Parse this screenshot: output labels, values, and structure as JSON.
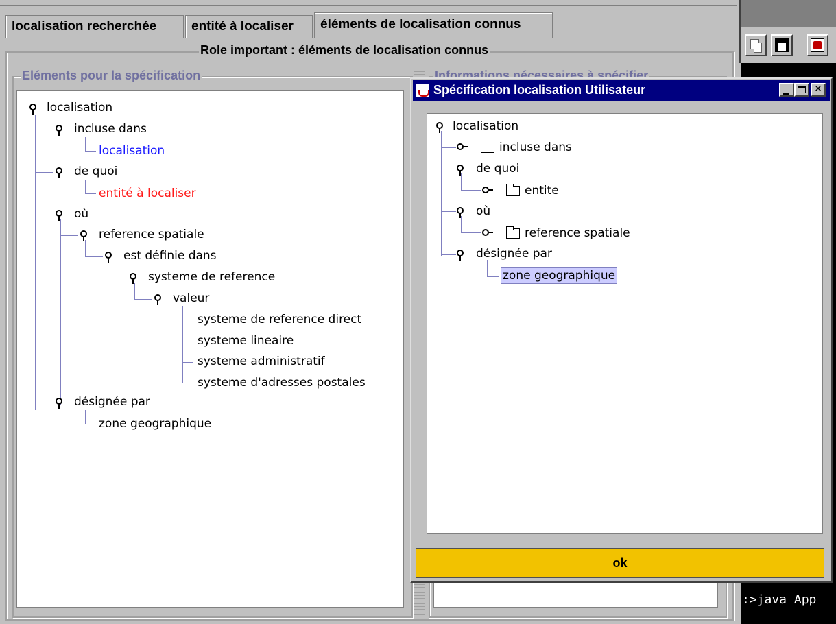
{
  "tabs": [
    {
      "label": "localisation recherchée"
    },
    {
      "label": "entité à localiser"
    },
    {
      "label": "éléments de localisation connus"
    }
  ],
  "main_panel": {
    "title": "Role important : éléments de localisation connus",
    "left_panel_title": "Eléments pour la spécification",
    "right_panel_title_partial": "Informations nécessaires à spécifier"
  },
  "left_tree": [
    {
      "label": "localisation"
    },
    {
      "label": "incluse dans"
    },
    {
      "label": "localisation",
      "color": "#1a1aff"
    },
    {
      "label": "de quoi"
    },
    {
      "label": "entité à localiser",
      "color": "#ff1a1a"
    },
    {
      "label": "où"
    },
    {
      "label": "reference spatiale"
    },
    {
      "label": "est définie dans"
    },
    {
      "label": "systeme de reference"
    },
    {
      "label": "valeur"
    },
    {
      "label": "systeme de reference direct"
    },
    {
      "label": "systeme lineaire"
    },
    {
      "label": "systeme administratif"
    },
    {
      "label": "systeme d'adresses postales"
    },
    {
      "label": "désignée par"
    },
    {
      "label": "zone geographique"
    }
  ],
  "dialog": {
    "title": "Spécification localisation Utilisateur",
    "tree": [
      {
        "label": "localisation"
      },
      {
        "label": "incluse dans"
      },
      {
        "label": "de quoi"
      },
      {
        "label": "entite"
      },
      {
        "label": "où"
      },
      {
        "label": "reference spatiale"
      },
      {
        "label": "désignée par"
      },
      {
        "label": "zone geographique",
        "selected": true
      }
    ],
    "ok_label": "ok"
  },
  "console": {
    "text": ":>java App"
  }
}
